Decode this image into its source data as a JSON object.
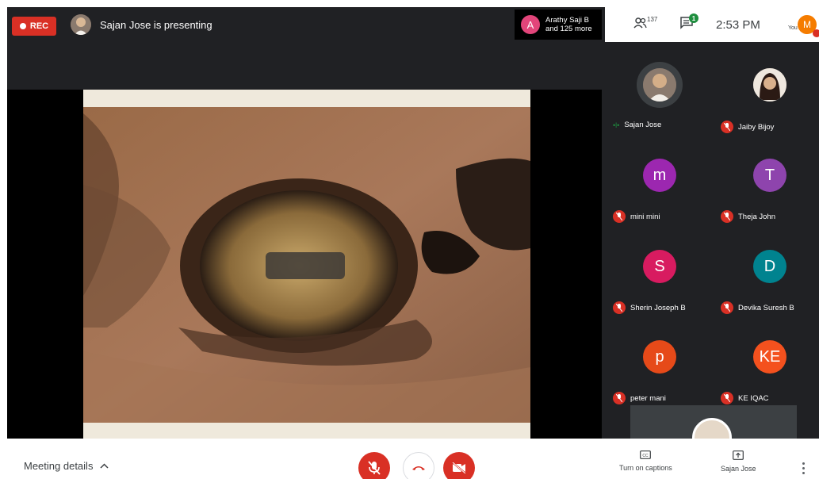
{
  "topbar": {
    "rec_label": "REC",
    "presenting_text": "Sajan Jose is presenting",
    "joined": {
      "avatar_initial": "A",
      "line1": "Arathy Saji B",
      "line2": "and 125 more"
    },
    "people_count": "137",
    "chat_badge": "1",
    "clock": "2:53 PM",
    "you_label": "You",
    "me_initial": "M"
  },
  "participants": [
    {
      "name": "Sajan Jose",
      "initial": "",
      "color": "#7a6a5e",
      "muted": false
    },
    {
      "name": "Jaiby Bijoy",
      "initial": "",
      "color": "#c8b0a0",
      "muted": true
    },
    {
      "name": "mini mini",
      "initial": "m",
      "color": "#9c27b0",
      "muted": true
    },
    {
      "name": "Theja John",
      "initial": "T",
      "color": "#8e44ad",
      "muted": true
    },
    {
      "name": "Sherin Joseph B",
      "initial": "S",
      "color": "#d81b60",
      "muted": true
    },
    {
      "name": "Devika Suresh B",
      "initial": "D",
      "color": "#00838f",
      "muted": true
    },
    {
      "name": "peter mani",
      "initial": "p",
      "color": "#e64a19",
      "muted": true
    },
    {
      "name": "KE IQAC",
      "initial": "KE",
      "color": "#f4511e",
      "muted": true
    }
  ],
  "bottombar": {
    "meeting_details": "Meeting details",
    "captions_label": "Turn on captions",
    "present_label": "Sajan Jose is presenting",
    "present_visible": "Sajan Jose"
  },
  "colors": {
    "rec": "#d93025",
    "control_red": "#d93025",
    "frame": "#202124"
  }
}
